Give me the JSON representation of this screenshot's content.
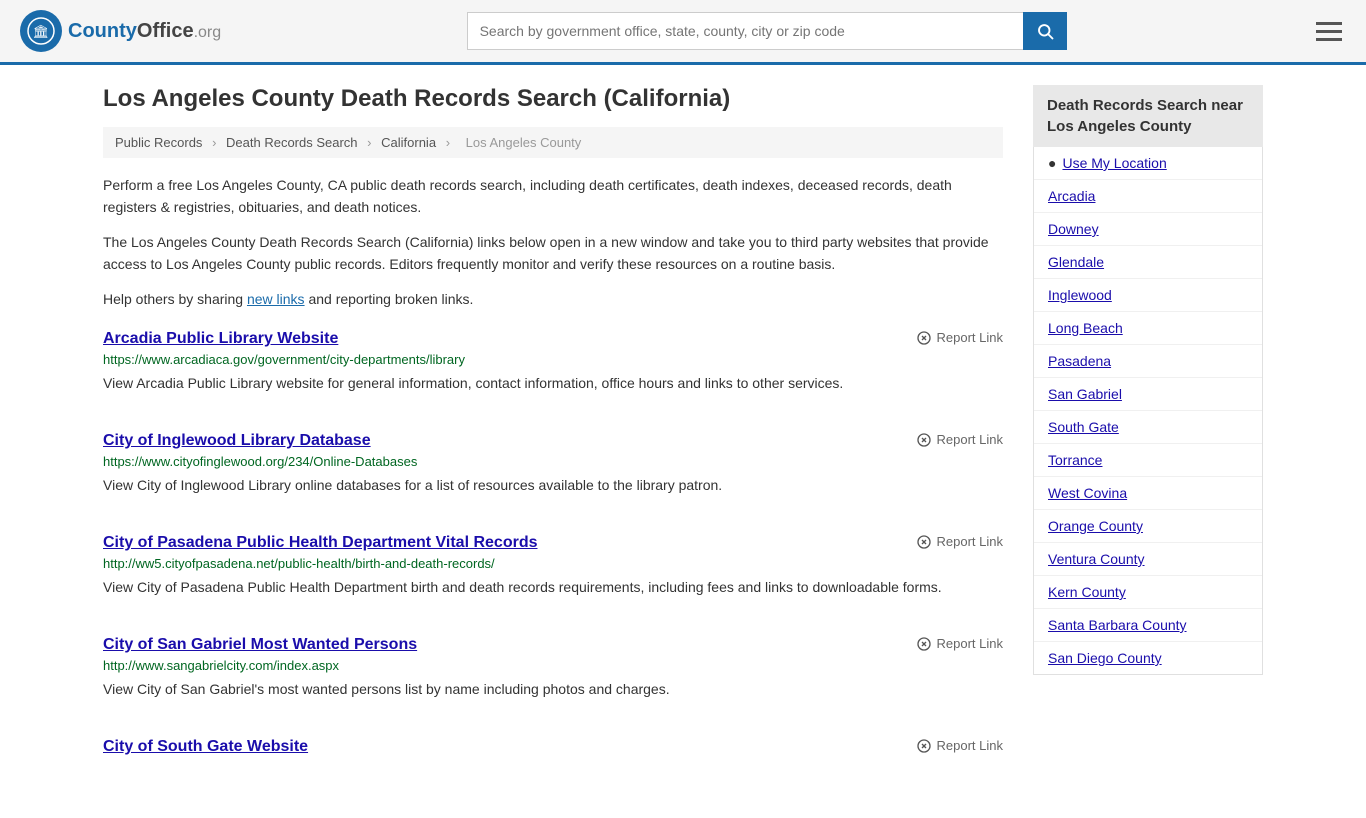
{
  "header": {
    "logo_icon": "🏛",
    "logo_name": "CountyOffice",
    "logo_org": ".org",
    "search_placeholder": "Search by government office, state, county, city or zip code",
    "search_value": ""
  },
  "page": {
    "title": "Los Angeles County Death Records Search (California)"
  },
  "breadcrumb": {
    "items": [
      "Public Records",
      "Death Records Search",
      "California",
      "Los Angeles County"
    ]
  },
  "intro": {
    "text1": "Perform a free Los Angeles County, CA public death records search, including death certificates, death indexes, deceased records, death registers & registries, obituaries, and death notices.",
    "text2": "The Los Angeles County Death Records Search (California) links below open in a new window and take you to third party websites that provide access to Los Angeles County public records. Editors frequently monitor and verify these resources on a routine basis.",
    "text3_pre": "Help others by sharing ",
    "text3_link": "new links",
    "text3_post": " and reporting broken links."
  },
  "results": [
    {
      "title": "Arcadia Public Library Website",
      "url": "https://www.arcadiaca.gov/government/city-departments/library",
      "desc": "View Arcadia Public Library website for general information, contact information, office hours and links to other services.",
      "report_label": "Report Link"
    },
    {
      "title": "City of Inglewood Library Database",
      "url": "https://www.cityofinglewood.org/234/Online-Databases",
      "desc": "View City of Inglewood Library online databases for a list of resources available to the library patron.",
      "report_label": "Report Link"
    },
    {
      "title": "City of Pasadena Public Health Department Vital Records",
      "url": "http://ww5.cityofpasadena.net/public-health/birth-and-death-records/",
      "desc": "View City of Pasadena Public Health Department birth and death records requirements, including fees and links to downloadable forms.",
      "report_label": "Report Link"
    },
    {
      "title": "City of San Gabriel Most Wanted Persons",
      "url": "http://www.sangabrielcity.com/index.aspx",
      "desc": "View City of San Gabriel's most wanted persons list by name including photos and charges.",
      "report_label": "Report Link"
    },
    {
      "title": "City of South Gate Website",
      "url": "",
      "desc": "",
      "report_label": "Report Link"
    }
  ],
  "sidebar": {
    "title": "Death Records Search near Los Angeles County",
    "use_location": "Use My Location",
    "items": [
      "Arcadia",
      "Downey",
      "Glendale",
      "Inglewood",
      "Long Beach",
      "Pasadena",
      "San Gabriel",
      "South Gate",
      "Torrance",
      "West Covina",
      "Orange County",
      "Ventura County",
      "Kern County",
      "Santa Barbara County",
      "San Diego County"
    ]
  }
}
